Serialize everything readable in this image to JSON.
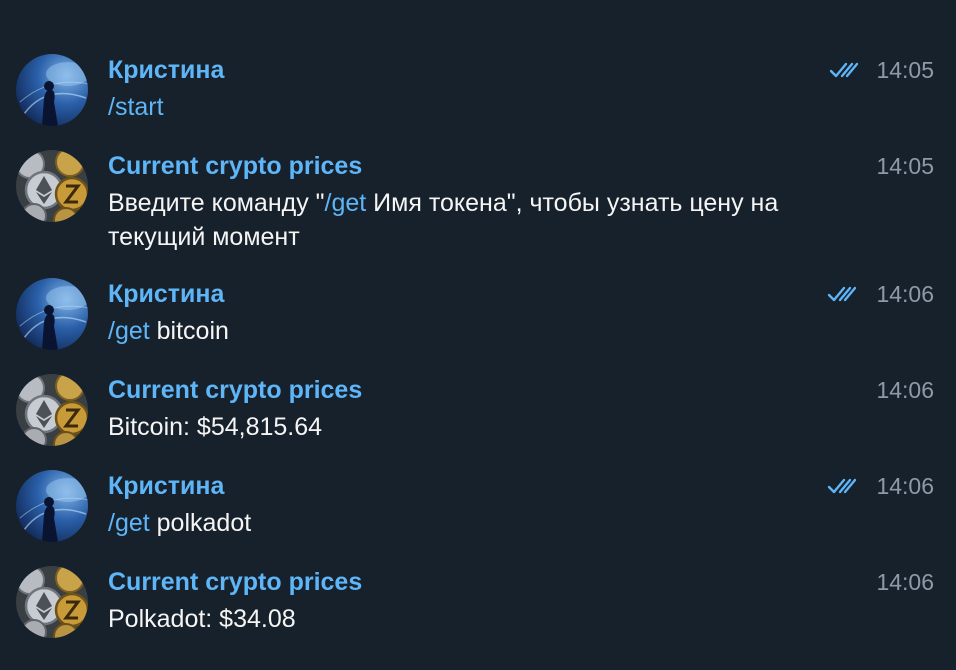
{
  "messages": [
    {
      "sender": "Кристина",
      "avatar": "user-avatar",
      "time": "14:05",
      "read": true,
      "command": "/start",
      "text_before": "",
      "text_after": ""
    },
    {
      "sender": "Current crypto prices",
      "avatar": "bot-avatar",
      "time": "14:05",
      "read": false,
      "text_before": "Введите команду \"",
      "command": "/get",
      "text_after": " Имя токена\", чтобы узнать цену на текущий момент"
    },
    {
      "sender": "Кристина",
      "avatar": "user-avatar",
      "time": "14:06",
      "read": true,
      "command": "/get",
      "text_before": "",
      "text_after": " bitcoin"
    },
    {
      "sender": "Current crypto prices",
      "avatar": "bot-avatar",
      "time": "14:06",
      "read": false,
      "text_before": "Bitcoin: $54,815.64",
      "command": "",
      "text_after": ""
    },
    {
      "sender": "Кристина",
      "avatar": "user-avatar",
      "time": "14:06",
      "read": true,
      "command": "/get",
      "text_before": "",
      "text_after": " polkadot"
    },
    {
      "sender": "Current crypto prices",
      "avatar": "bot-avatar",
      "time": "14:06",
      "read": false,
      "text_before": "Polkadot: $34.08",
      "command": "",
      "text_after": ""
    }
  ],
  "colors": {
    "background": "#17212b",
    "sender_name": "#5eb5f7",
    "command_link": "#5eb5f7",
    "timestamp": "#8e9aa6",
    "read_check": "#5eb5f7"
  }
}
